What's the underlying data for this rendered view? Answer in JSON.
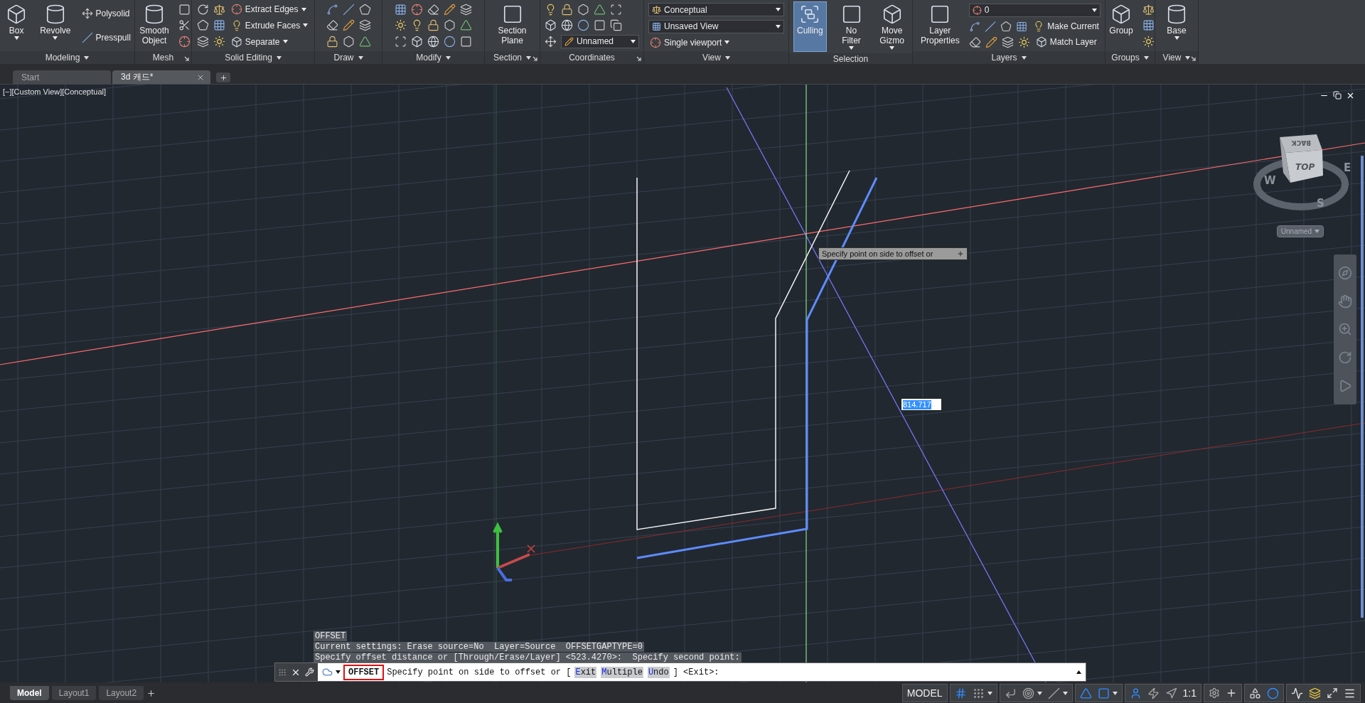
{
  "ribbon": {
    "panels": [
      {
        "title": "Modeling",
        "menu": true,
        "launcher": false,
        "blocks": [
          {
            "kind": "large",
            "label": "Box",
            "menu": true,
            "on": false
          },
          {
            "kind": "large",
            "label": "Revolve",
            "menu": true,
            "on": false
          },
          {
            "kind": "rows",
            "rows": [
              [
                {
                  "kind": "text",
                  "label": "Polysolid",
                  "menu": false
                }
              ],
              [
                {
                  "kind": "text",
                  "label": "Presspull",
                  "menu": false
                }
              ]
            ]
          }
        ]
      },
      {
        "title": "Mesh",
        "menu": false,
        "launcher": true,
        "blocks": [
          {
            "kind": "large",
            "label": "Smooth\nObject",
            "menu": false,
            "on": false
          },
          {
            "kind": "rows",
            "rows": [
              [
                {
                  "kind": "icon"
                }
              ],
              [
                {
                  "kind": "icon"
                }
              ],
              [
                {
                  "kind": "icon"
                }
              ]
            ]
          }
        ]
      },
      {
        "title": "Solid Editing",
        "menu": true,
        "launcher": false,
        "blocks": [
          {
            "kind": "rows",
            "rows": [
              [
                {
                  "kind": "icon"
                },
                {
                  "kind": "icon"
                },
                {
                  "kind": "text",
                  "label": "Extract Edges",
                  "menu": true
                }
              ],
              [
                {
                  "kind": "icon"
                },
                {
                  "kind": "icon"
                },
                {
                  "kind": "text",
                  "label": "Extrude Faces",
                  "menu": true
                }
              ],
              [
                {
                  "kind": "icon"
                },
                {
                  "kind": "icon"
                },
                {
                  "kind": "text",
                  "label": "Separate",
                  "menu": true
                }
              ]
            ]
          }
        ]
      },
      {
        "title": "Draw",
        "menu": true,
        "launcher": false,
        "blocks": [
          {
            "kind": "rows",
            "rows": [
              [
                {
                  "kind": "icon"
                },
                {
                  "kind": "icon"
                },
                {
                  "kind": "icon"
                }
              ],
              [
                {
                  "kind": "icon"
                },
                {
                  "kind": "icon"
                },
                {
                  "kind": "icon"
                }
              ],
              [
                {
                  "kind": "icon"
                },
                {
                  "kind": "icon"
                },
                {
                  "kind": "icon"
                }
              ]
            ]
          }
        ]
      },
      {
        "title": "Modify",
        "menu": true,
        "launcher": false,
        "blocks": [
          {
            "kind": "rows",
            "rows": [
              [
                {
                  "kind": "icon"
                },
                {
                  "kind": "icon"
                },
                {
                  "kind": "icon"
                },
                {
                  "kind": "icon"
                },
                {
                  "kind": "icon"
                }
              ],
              [
                {
                  "kind": "icon"
                },
                {
                  "kind": "icon"
                },
                {
                  "kind": "icon"
                },
                {
                  "kind": "icon"
                },
                {
                  "kind": "icon"
                }
              ],
              [
                {
                  "kind": "icon"
                },
                {
                  "kind": "icon"
                },
                {
                  "kind": "icon"
                },
                {
                  "kind": "icon"
                },
                {
                  "kind": "icon"
                }
              ]
            ]
          }
        ]
      },
      {
        "title": "Section",
        "menu": true,
        "launcher": true,
        "blocks": [
          {
            "kind": "large",
            "label": "Section\nPlane",
            "menu": false,
            "on": false
          }
        ]
      },
      {
        "title": "Coordinates",
        "menu": false,
        "launcher": true,
        "blocks": [
          {
            "kind": "rows",
            "rows": [
              [
                {
                  "kind": "icon"
                },
                {
                  "kind": "icon"
                },
                {
                  "kind": "icon"
                },
                {
                  "kind": "icon"
                },
                {
                  "kind": "icon"
                }
              ],
              [
                {
                  "kind": "icon"
                },
                {
                  "kind": "icon"
                },
                {
                  "kind": "icon"
                },
                {
                  "kind": "icon"
                },
                {
                  "kind": "icon"
                }
              ],
              [
                {
                  "kind": "icon"
                },
                {
                  "kind": "select",
                  "value": "Unnamed"
                }
              ]
            ]
          }
        ]
      },
      {
        "title": "View",
        "menu": true,
        "launcher": false,
        "blocks": [
          {
            "kind": "rows",
            "rows": [
              [
                {
                  "kind": "select",
                  "value": "Conceptual"
                }
              ],
              [
                {
                  "kind": "select",
                  "value": "Unsaved View"
                }
              ],
              [
                {
                  "kind": "text",
                  "label": "Single viewport",
                  "menu": true
                }
              ]
            ]
          }
        ]
      },
      {
        "title": "Selection",
        "menu": false,
        "launcher": false,
        "blocks": [
          {
            "kind": "large",
            "label": "Culling",
            "menu": false,
            "on": true
          },
          {
            "kind": "large",
            "label": "No Filter",
            "menu": true,
            "on": false
          },
          {
            "kind": "large",
            "label": "Move\nGizmo",
            "menu": true,
            "on": false
          }
        ]
      },
      {
        "title": "Layers",
        "menu": true,
        "launcher": false,
        "blocks": [
          {
            "kind": "large",
            "label": "Layer\nProperties",
            "menu": false,
            "on": false
          },
          {
            "kind": "rows",
            "rows": [
              [
                {
                  "kind": "select",
                  "value": "0"
                }
              ],
              [
                {
                  "kind": "icon"
                },
                {
                  "kind": "icon"
                },
                {
                  "kind": "icon"
                },
                {
                  "kind": "icon"
                },
                {
                  "kind": "text",
                  "label": "Make Current",
                  "menu": false
                }
              ],
              [
                {
                  "kind": "icon"
                },
                {
                  "kind": "icon"
                },
                {
                  "kind": "icon"
                },
                {
                  "kind": "icon"
                },
                {
                  "kind": "text",
                  "label": "Match Layer",
                  "menu": false
                }
              ]
            ]
          }
        ]
      },
      {
        "title": "Groups",
        "menu": true,
        "launcher": false,
        "blocks": [
          {
            "kind": "large",
            "label": "Group",
            "menu": false,
            "on": false
          },
          {
            "kind": "rows",
            "rows": [
              [
                {
                  "kind": "icon"
                }
              ],
              [
                {
                  "kind": "icon"
                }
              ],
              [
                {
                  "kind": "icon"
                }
              ]
            ]
          }
        ]
      },
      {
        "title": "View",
        "menu": true,
        "launcher": true,
        "blocks": [
          {
            "kind": "large",
            "label": "Base",
            "menu": true,
            "on": false
          }
        ]
      }
    ]
  },
  "file_tabs": [
    {
      "label": "Start",
      "selected": false
    },
    {
      "label": "3d 캐드*",
      "selected": true
    }
  ],
  "viewport": {
    "label": "[−][Custom View][Conceptual]",
    "tooltip": "Specify point on side to offset or",
    "dynamic_input": "814.717",
    "viewcube": {
      "top": "TOP",
      "back": "BACK",
      "compass": [
        "W",
        "E",
        "S"
      ],
      "view_name": "Unnamed"
    }
  },
  "command": {
    "history": [
      "OFFSET",
      "Current settings: Erase source=No  Layer=Source  OFFSETGAPTYPE=0",
      "Specify offset distance or [Through/Erase/Layer] <523.4270>:  Specify second point:"
    ],
    "command": "OFFSET",
    "prompt": "Specify point on side to offset or [",
    "options": [
      "Exit",
      "Multiple",
      "Undo"
    ],
    "prompt_end": "] <Exit>:"
  },
  "layout_tabs": [
    {
      "label": "Model",
      "selected": true
    },
    {
      "label": "Layout1",
      "selected": false
    },
    {
      "label": "Layout2",
      "selected": false
    }
  ],
  "status_bar": {
    "space": "MODEL",
    "toggles": [
      {
        "on": true,
        "menu": false
      },
      {
        "on": false,
        "menu": true
      },
      {
        "on": false,
        "menu": false
      },
      {
        "on": false,
        "menu": true
      },
      {
        "on": false,
        "menu": true
      },
      {
        "on": true,
        "menu": false
      },
      {
        "on": true,
        "menu": true
      },
      {
        "on": true,
        "menu": false
      },
      {
        "on": false,
        "menu": false
      },
      {
        "on": false,
        "menu": false
      }
    ],
    "scale": "1:1"
  }
}
